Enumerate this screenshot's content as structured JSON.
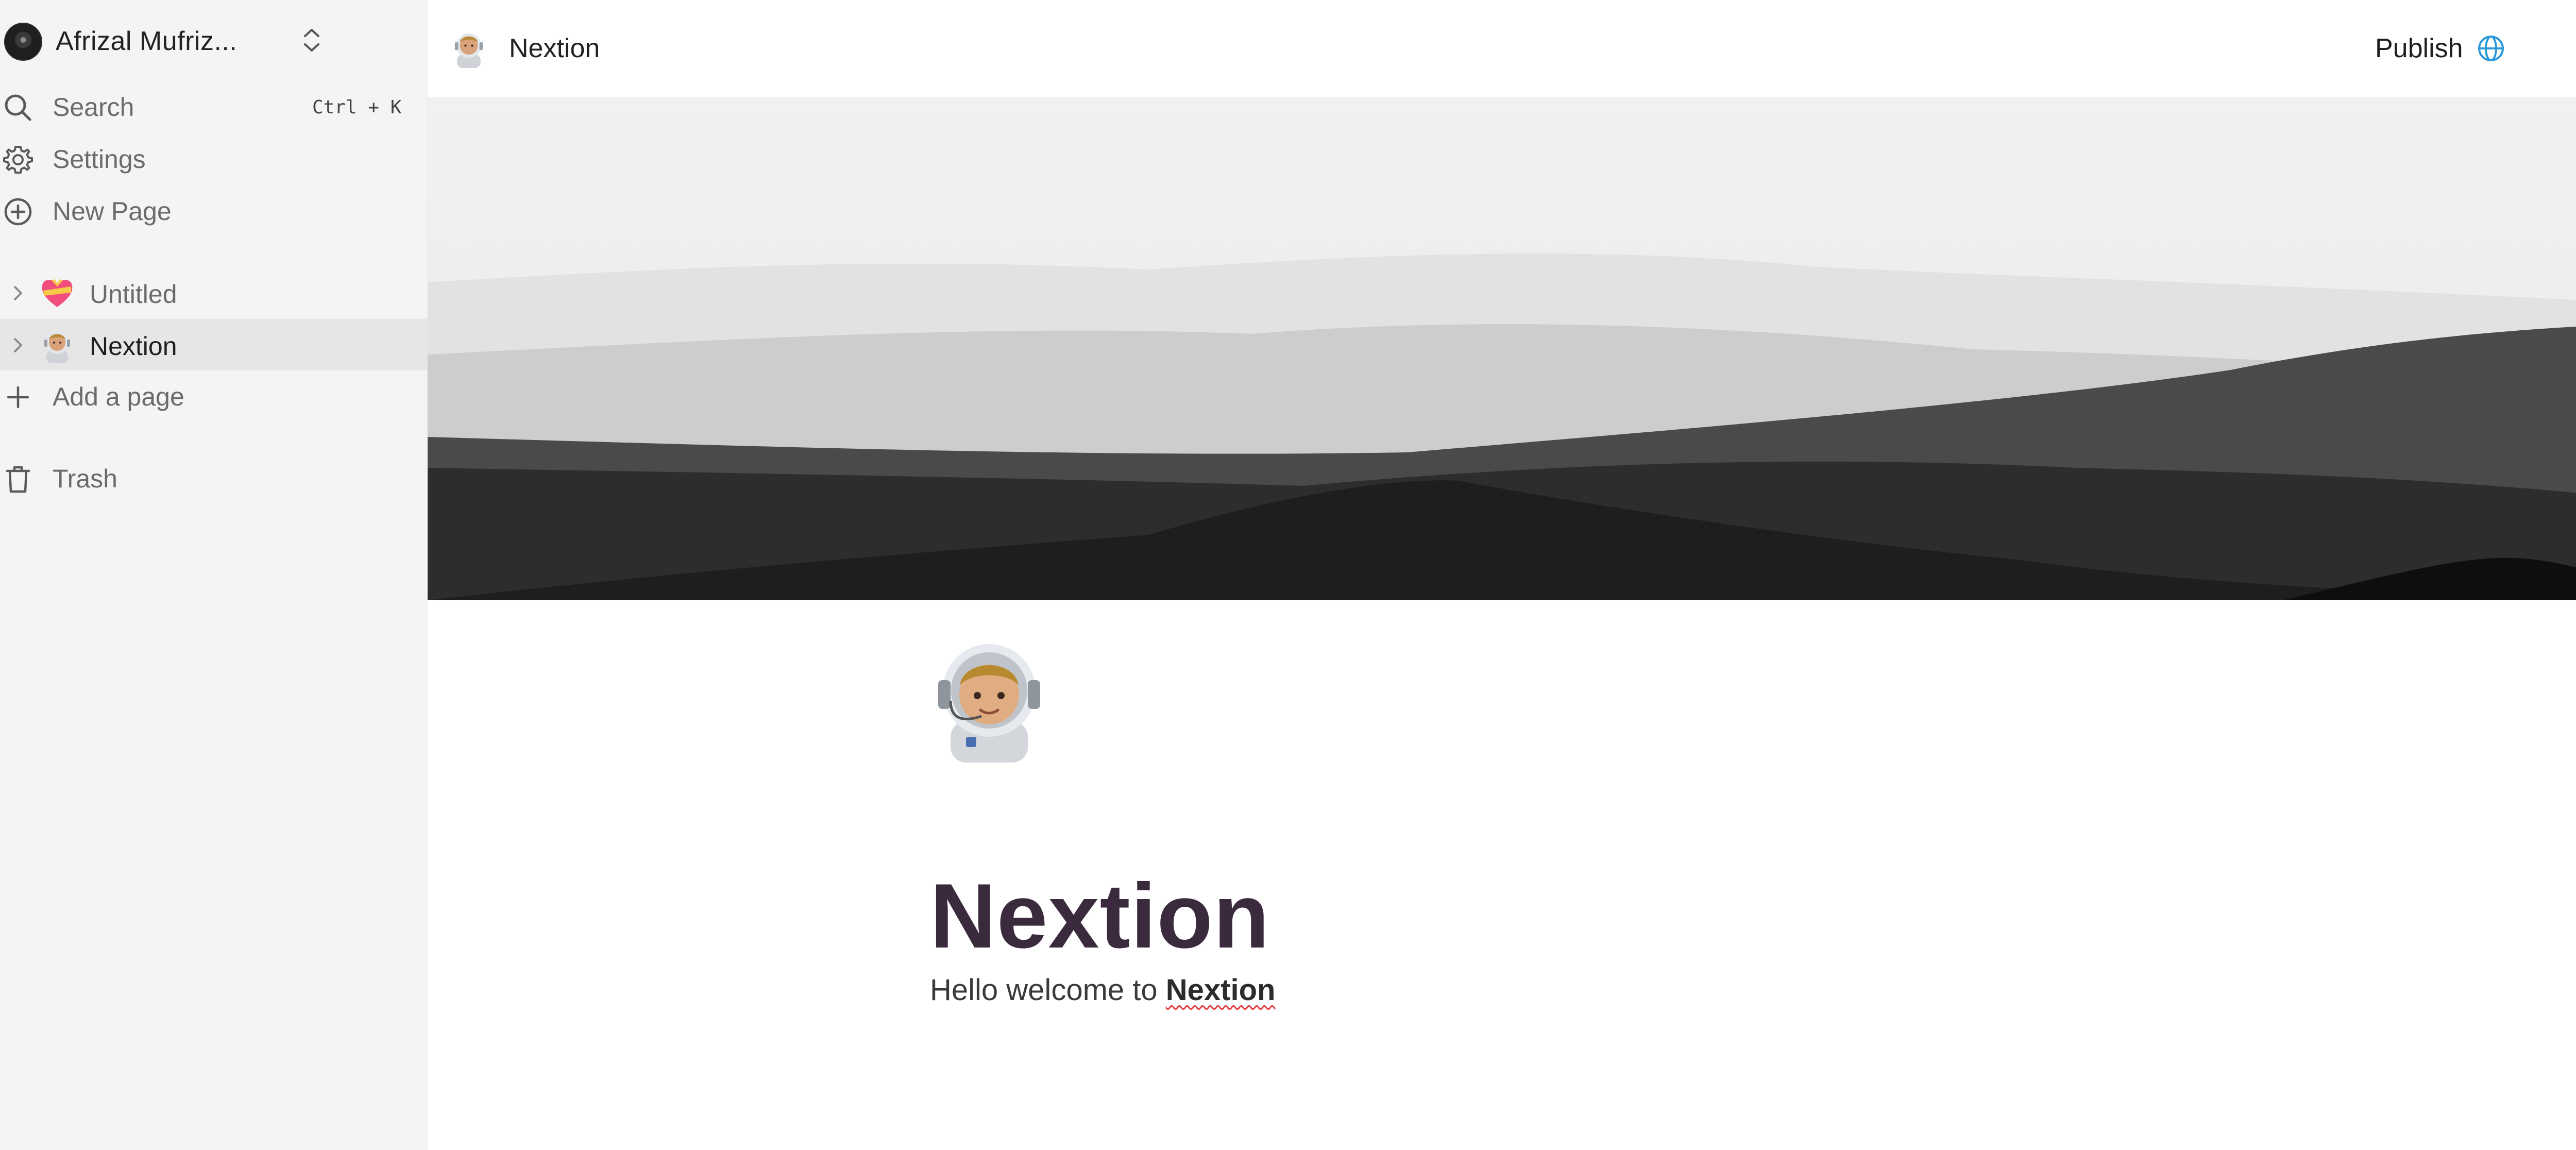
{
  "workspace": {
    "name": "Afrizal Mufriz...",
    "avatar_icon": "workspace-avatar",
    "switch_icon": "chevron-up-down-icon"
  },
  "sidebar": {
    "search": {
      "label": "Search",
      "shortcut": "Ctrl + K",
      "icon": "search-icon"
    },
    "settings": {
      "label": "Settings",
      "icon": "gear-icon"
    },
    "new_page": {
      "label": "New Page",
      "icon": "plus-circle-icon"
    },
    "pages": [
      {
        "label": "Untitled",
        "emoji": "heart-with-ribbon",
        "active": false
      },
      {
        "label": "Nextion",
        "emoji": "astronaut",
        "active": true
      }
    ],
    "add_page": {
      "label": "Add a page",
      "icon": "plus-icon"
    },
    "trash": {
      "label": "Trash",
      "icon": "trash-icon"
    }
  },
  "topbar": {
    "breadcrumb_title": "Nextion",
    "breadcrumb_emoji": "astronaut",
    "publish_label": "Publish",
    "publish_icon": "globe-icon",
    "more_icon": "more-horizontal-icon"
  },
  "document": {
    "icon": "astronaut",
    "title": "Nextion",
    "body_prefix": "Hello welcome to ",
    "body_strong": "Nextion"
  },
  "colors": {
    "sidebar_bg": "#f4f4f4",
    "active_item_bg": "#e6e6e6",
    "title_color": "#3b2a3d",
    "globe_color": "#2e9ad8",
    "spellcheck_underline": "#e03e3e"
  }
}
